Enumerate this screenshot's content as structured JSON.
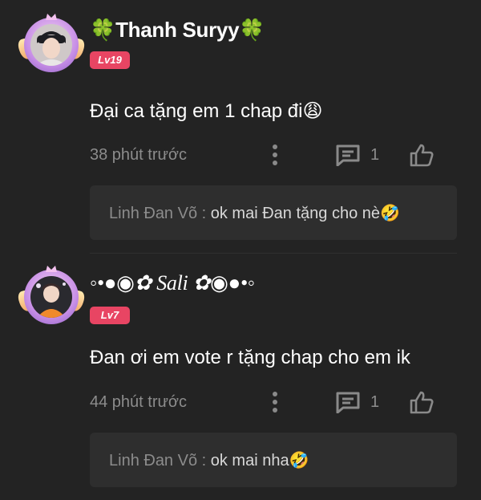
{
  "comments": [
    {
      "username": "🍀Thanh Suryy🍀",
      "level": "Lv19",
      "text": "Đại ca tặng em 1 chap đi😩",
      "time": "38 phút trước",
      "reply_count": "1",
      "reply": {
        "author": "Linh Đan Võ",
        "separator": " : ",
        "text": "ok mai Đan tặng cho nè🤣"
      }
    },
    {
      "username": "◦•●◉✿ Sali ✿◉●•◦",
      "level": "Lv7",
      "text": "Đan ơi em vote r tặng chap cho em ik",
      "time": "44 phút trước",
      "reply_count": "1",
      "reply": {
        "author": "Linh Đan Võ",
        "separator": " : ",
        "text": "ok mai nha🤣"
      }
    }
  ],
  "colors": {
    "background": "#232323",
    "level_badge": "#e84563",
    "muted_text": "#8c8c8c",
    "reply_box": "#2e2e2e"
  },
  "icons": {
    "more": "more-vertical-icon",
    "reply": "comment-icon",
    "like": "thumbs-up-icon"
  }
}
